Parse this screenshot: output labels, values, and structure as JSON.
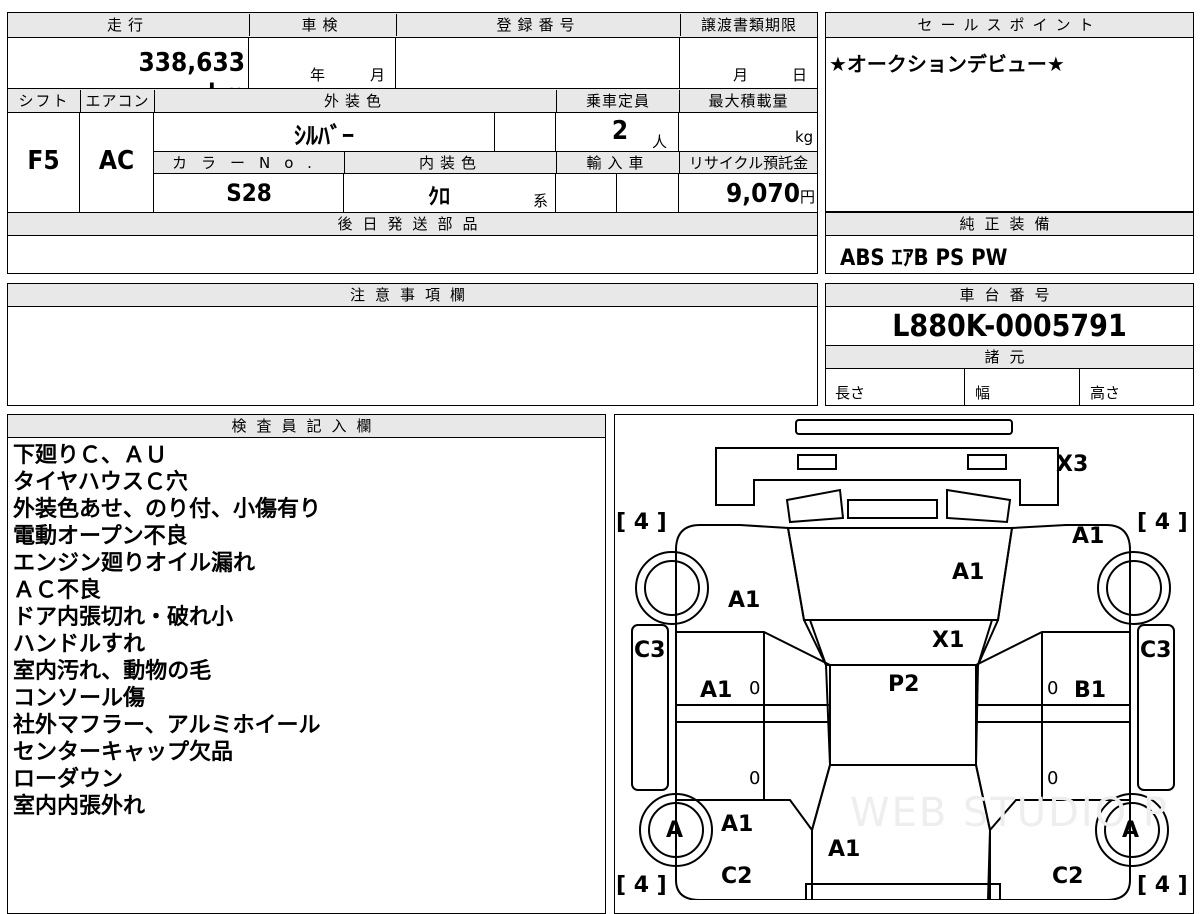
{
  "sheet": {
    "mileage_label": "走行",
    "mileage_value": "338,633",
    "mileage_unit": "km",
    "shaken_label": "車検",
    "shaken_year_unit": "年",
    "shaken_month_unit": "月",
    "reg_label": "登録番号",
    "transfer_label": "譲渡書類期限",
    "transfer_month_unit": "月",
    "transfer_day_unit": "日",
    "shift_label": "シフト",
    "shift_value": "F5",
    "ac_label": "エアコン",
    "ac_value": "AC",
    "ext_color_label": "外装色",
    "ext_color_value": "ｼﾙﾊﾞｰ",
    "capacity_label": "乗車定員",
    "capacity_value": "2",
    "capacity_unit": "人",
    "load_label": "最大積載量",
    "load_unit": "kg",
    "color_no_label": "カラーNo.",
    "color_no_value": "S28",
    "int_color_label": "内装色",
    "int_color_value": "ｸﾛ",
    "int_color_unit": "系",
    "import_label": "輸入車",
    "recycle_label": "リサイクル預託金",
    "recycle_value": "9,070",
    "recycle_unit": "円",
    "later_parts_label": "後日発送部品",
    "sales_point_label": "セールスポイント",
    "sales_point_value": "★オークションデビュー★",
    "equipment_label": "純正装備",
    "equipment_value": "ABS ｴｱB PS PW",
    "caution_label": "注意事項欄",
    "chassis_label": "車台番号",
    "chassis_value": "L880K-0005791",
    "spec_label": "諸元",
    "length_label": "長さ",
    "width_label": "幅",
    "height_label": "高さ",
    "inspector_label": "検査員記入欄",
    "inspector_notes": [
      "下廻りＣ、ＡＵ",
      "タイヤハウスＣ穴",
      "外装色あせ、のり付、小傷有り",
      "電動オープン不良",
      "エンジン廻りオイル漏れ",
      "ＡＣ不良",
      "ドア内張切れ・破れ小",
      "ハンドルすれ",
      "室内汚れ、動物の毛",
      "コンソール傷",
      "社外マフラー、アルミホイール",
      "センターキャップ欠品",
      "ローダウン",
      "室内内張外れ"
    ]
  },
  "diagram": {
    "tread_fl": "[ 4 ]",
    "tread_fr": "[ 4 ]",
    "tread_rl": "[ 4 ]",
    "tread_rr": "[ 4 ]",
    "marks": {
      "bumper_front": "X3",
      "fender_fr": "A1",
      "fender_fl": "A1",
      "hood": "A1",
      "windshield": "X1",
      "pillar_l": "C3",
      "pillar_r": "C3",
      "door_l": "A1",
      "door_r": "B1",
      "roof": "P2",
      "wheel_rl": "A",
      "wheel_rr": "A",
      "quarter_l": "A1",
      "trunk": "A1",
      "rear_l": "C2",
      "rear_r": "C2",
      "zero_1": "0",
      "zero_2": "0",
      "zero_3": "0",
      "zero_4": "0"
    },
    "watermark": "WEB STUDIO P"
  }
}
